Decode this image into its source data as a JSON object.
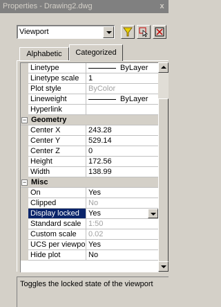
{
  "window": {
    "title": "Properties - Drawing2.dwg",
    "close_glyph": "x"
  },
  "selector": {
    "value": "Viewport"
  },
  "toolbar": {
    "icons": [
      "quick-select-icon",
      "select-objects-icon",
      "toggle-pickadd-icon"
    ]
  },
  "tabs": {
    "alphabetic": "Alphabetic",
    "categorized": "Categorized",
    "active": "Categorized"
  },
  "rows": [
    {
      "name": "Linetype",
      "value": "ByLayer",
      "line": true
    },
    {
      "name": "Linetype scale",
      "value": "1"
    },
    {
      "name": "Plot style",
      "value": "ByColor",
      "dim": true
    },
    {
      "name": "Lineweight",
      "value": "ByLayer",
      "line": true
    },
    {
      "name": "Hyperlink",
      "value": ""
    },
    {
      "category": "Geometry",
      "toggle": "−"
    },
    {
      "name": "Center X",
      "value": "243.28"
    },
    {
      "name": "Center Y",
      "value": "529.14"
    },
    {
      "name": "Center Z",
      "value": "0"
    },
    {
      "name": "Height",
      "value": "172.56"
    },
    {
      "name": "Width",
      "value": "138.99"
    },
    {
      "category": "Misc",
      "toggle": "−"
    },
    {
      "name": "On",
      "value": "Yes"
    },
    {
      "name": "Clipped",
      "value": "No",
      "dim": true
    },
    {
      "name": "Display locked",
      "value": "Yes",
      "selected": true
    },
    {
      "name": "Standard scale",
      "value": "1:50",
      "dim": true
    },
    {
      "name": "Custom scale",
      "value": "0.02",
      "dim": true
    },
    {
      "name": "UCS per viewport",
      "value": "Yes"
    },
    {
      "name": "Hide plot",
      "value": "No"
    }
  ],
  "description": "Toggles the locked state of the viewport",
  "colors": {
    "selection": "#0a246a",
    "panel": "#d4d0c8",
    "titlebar_inactive": "#808080"
  }
}
